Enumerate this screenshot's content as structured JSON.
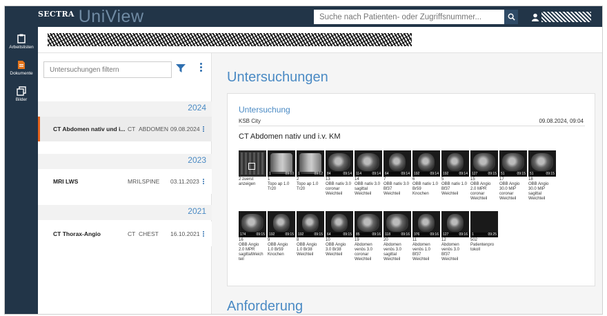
{
  "app": {
    "vendor": "SECTRA",
    "product": "UniView"
  },
  "search": {
    "placeholder": "Suche nach Patienten- oder Zugriffsnummer..."
  },
  "nav": [
    {
      "label": "Arbeitslisten",
      "icon": "clipboard-icon"
    },
    {
      "label": "Dokumente",
      "icon": "document-icon"
    },
    {
      "label": "Bilder",
      "icon": "images-icon"
    }
  ],
  "studies": {
    "filter_placeholder": "Untersuchungen filtern",
    "groups": [
      {
        "year": "2024",
        "rows": [
          {
            "title": "CT Abdomen nativ und i...",
            "modality": "CT",
            "body": "ABDOMEN",
            "date": "09.08.2024",
            "selected": true
          }
        ]
      },
      {
        "year": "2023",
        "rows": [
          {
            "title": "MRI LWS",
            "modality": "MRI",
            "body": "LSPINE",
            "date": "03.11.2023",
            "selected": false
          }
        ]
      },
      {
        "year": "2021",
        "rows": [
          {
            "title": "CT Thorax-Angio",
            "modality": "CT",
            "body": "CHEST",
            "date": "16.10.2021",
            "selected": false
          }
        ]
      }
    ]
  },
  "main": {
    "title": "Untersuchungen",
    "card": {
      "heading": "Untersuchung",
      "site": "KSB City",
      "datetime": "09.08.2024, 09:04",
      "study_title": "CT Abdomen nativ und i.v. KM"
    },
    "series_row1": [
      {
        "caption": "2 zuerst\nanzeigen",
        "kind": "placeholder",
        "count": "",
        "time": ""
      },
      {
        "caption": "1\nTopo ap 1.0\nTr20",
        "kind": "scout",
        "count": "1",
        "time": "09:10"
      },
      {
        "caption": "2\nTopo ap 1.0\nTr20",
        "kind": "scout",
        "count": "1",
        "time": "09:12"
      },
      {
        "caption": "13\nOBB nativ 3.0\ncoronar\nWeichteil",
        "kind": "wide",
        "count": "84",
        "time": "09:14"
      },
      {
        "caption": "14\nOBB nativ 3.0\nsagittal\nWeichteil",
        "kind": "wide",
        "count": "114",
        "time": "09:14"
      },
      {
        "caption": "7\nOBB nativ 3.0\nBf37\nWeichteil",
        "kind": "round",
        "count": "64",
        "time": "09:14"
      },
      {
        "caption": "6\nOBB nativ 1.0\nBr59\nKnochen",
        "kind": "round",
        "count": "192",
        "time": "09:14"
      },
      {
        "caption": "5\nOBB nativ 1.0\nBf37\nWeichteil",
        "kind": "round",
        "count": "192",
        "time": "09:14"
      },
      {
        "caption": "15\nOBB Angio\n2.0 MPR\ncoronar\nWeichteil",
        "kind": "wide",
        "count": "127",
        "time": "09:15"
      },
      {
        "caption": "17\nOBB Angio\n30.0 MIP\ncoronar\nWeichteil",
        "kind": "wide",
        "count": "51",
        "time": "09:15"
      },
      {
        "caption": "18\nOBB Angio\n30.0 MIP\nsagittal\nWeichteil",
        "kind": "wide",
        "count": "51",
        "time": "09:15"
      }
    ],
    "series_row2": [
      {
        "caption": "16\nOBB Angio\n2.0 MPR\nsagittalWeich\nteil",
        "kind": "wide",
        "count": "174",
        "time": "09:15"
      },
      {
        "caption": "9\nOBB Angio\n1.0 Br59\nKnochen",
        "kind": "round",
        "count": "192",
        "time": "09:15"
      },
      {
        "caption": "8\nOBB Angio\n1.0 Br38\nWeichteil",
        "kind": "round",
        "count": "192",
        "time": "09:15"
      },
      {
        "caption": "10\nOBB Angio\n3.0 Br38\nWeichteil",
        "kind": "round",
        "count": "64",
        "time": "09:15"
      },
      {
        "caption": "19\nAbdomen\nvenös 3.0\ncoronar\nWeichteil",
        "kind": "wide",
        "count": "85",
        "time": "09:16"
      },
      {
        "caption": "20\nAbdomen\nvenös 3.0\nsagittal\nWeichteil",
        "kind": "wide",
        "count": "118",
        "time": "09:16"
      },
      {
        "caption": "11\nAbdomen\nvenös 1.0\nBf37\nWeichteil",
        "kind": "round",
        "count": "376",
        "time": "09:16"
      },
      {
        "caption": "12\nAbdomen\nvenös 3.0\nBf37\nWeichteil",
        "kind": "round",
        "count": "127",
        "time": "09:16"
      },
      {
        "caption": "502\nPatientenpro\ntokoll",
        "kind": "blank",
        "count": "1",
        "time": "09:25"
      }
    ],
    "request_title": "Anforderung"
  }
}
